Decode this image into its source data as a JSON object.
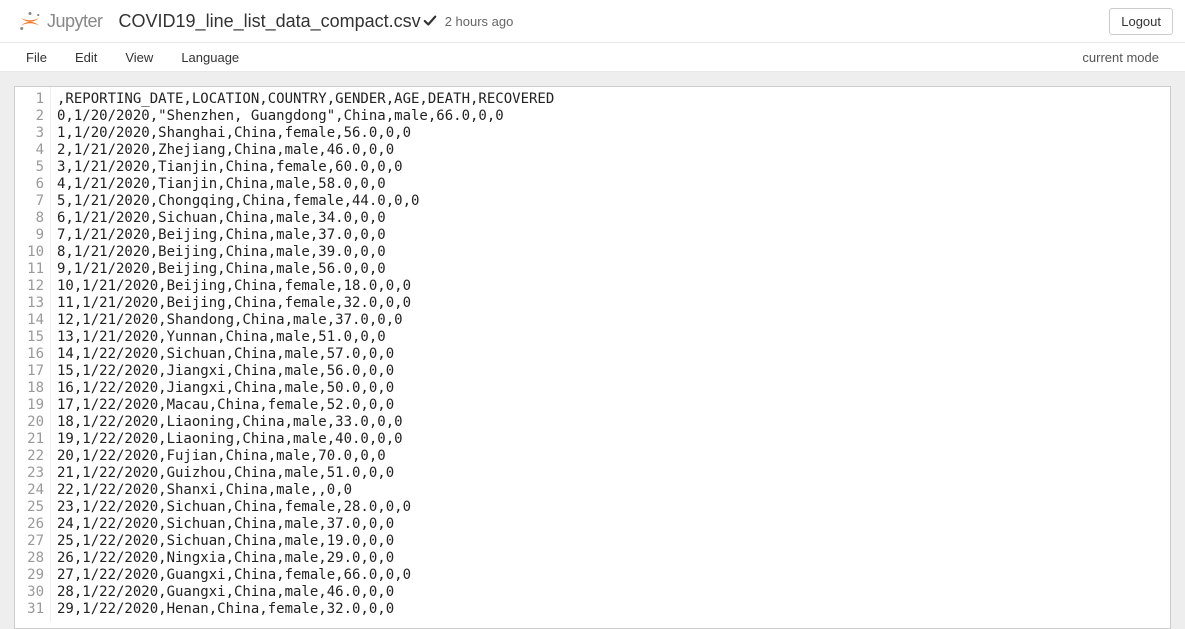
{
  "header": {
    "logo_text": "Jupyter",
    "file_title": "COVID19_line_list_data_compact.csv",
    "timestamp": "2 hours ago",
    "logout_label": "Logout"
  },
  "menubar": {
    "items": [
      {
        "label": "File"
      },
      {
        "label": "Edit"
      },
      {
        "label": "View"
      },
      {
        "label": "Language"
      }
    ],
    "mode": "current mode"
  },
  "file_lines": [
    ",REPORTING_DATE,LOCATION,COUNTRY,GENDER,AGE,DEATH,RECOVERED",
    "0,1/20/2020,\"Shenzhen, Guangdong\",China,male,66.0,0,0",
    "1,1/20/2020,Shanghai,China,female,56.0,0,0",
    "2,1/21/2020,Zhejiang,China,male,46.0,0,0",
    "3,1/21/2020,Tianjin,China,female,60.0,0,0",
    "4,1/21/2020,Tianjin,China,male,58.0,0,0",
    "5,1/21/2020,Chongqing,China,female,44.0,0,0",
    "6,1/21/2020,Sichuan,China,male,34.0,0,0",
    "7,1/21/2020,Beijing,China,male,37.0,0,0",
    "8,1/21/2020,Beijing,China,male,39.0,0,0",
    "9,1/21/2020,Beijing,China,male,56.0,0,0",
    "10,1/21/2020,Beijing,China,female,18.0,0,0",
    "11,1/21/2020,Beijing,China,female,32.0,0,0",
    "12,1/21/2020,Shandong,China,male,37.0,0,0",
    "13,1/21/2020,Yunnan,China,male,51.0,0,0",
    "14,1/22/2020,Sichuan,China,male,57.0,0,0",
    "15,1/22/2020,Jiangxi,China,male,56.0,0,0",
    "16,1/22/2020,Jiangxi,China,male,50.0,0,0",
    "17,1/22/2020,Macau,China,female,52.0,0,0",
    "18,1/22/2020,Liaoning,China,male,33.0,0,0",
    "19,1/22/2020,Liaoning,China,male,40.0,0,0",
    "20,1/22/2020,Fujian,China,male,70.0,0,0",
    "21,1/22/2020,Guizhou,China,male,51.0,0,0",
    "22,1/22/2020,Shanxi,China,male,,0,0",
    "23,1/22/2020,Sichuan,China,female,28.0,0,0",
    "24,1/22/2020,Sichuan,China,male,37.0,0,0",
    "25,1/22/2020,Sichuan,China,male,19.0,0,0",
    "26,1/22/2020,Ningxia,China,male,29.0,0,0",
    "27,1/22/2020,Guangxi,China,female,66.0,0,0",
    "28,1/22/2020,Guangxi,China,male,46.0,0,0",
    "29,1/22/2020,Henan,China,female,32.0,0,0"
  ]
}
